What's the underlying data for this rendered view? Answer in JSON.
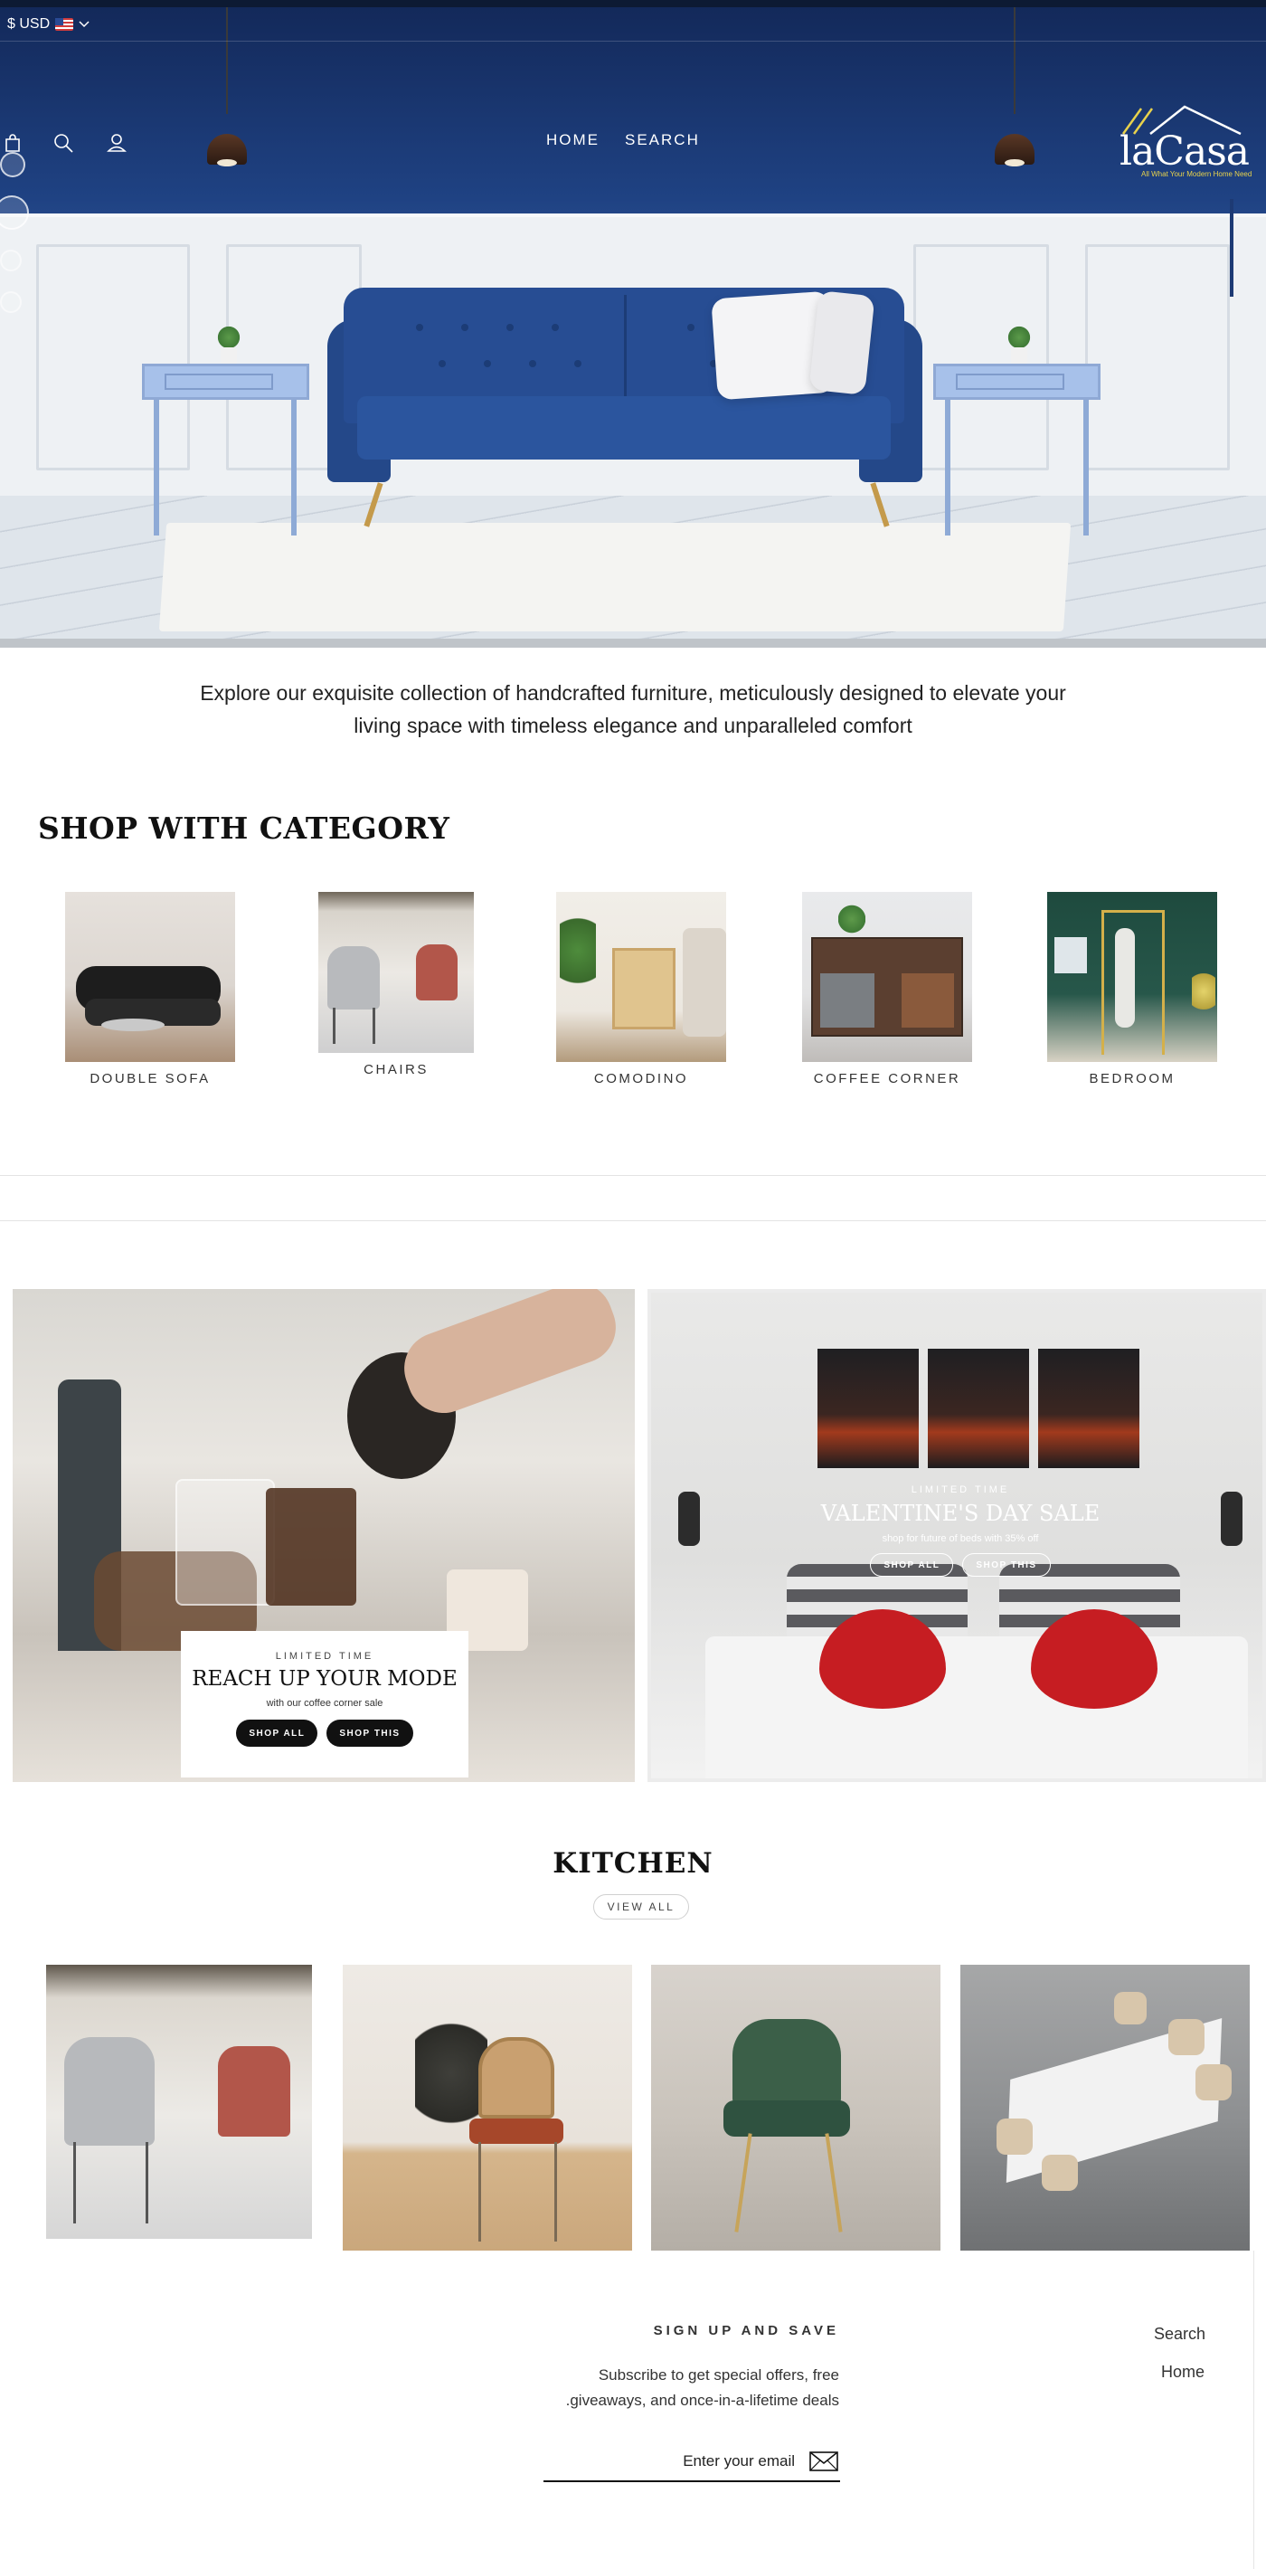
{
  "header": {
    "currency": "$ USD",
    "nav": [
      "HOME",
      "SEARCH"
    ],
    "logo": {
      "text": "laCasa",
      "tagline": "All What Your Modern Home Need"
    }
  },
  "intro": {
    "text": "Explore our exquisite collection of handcrafted furniture, meticulously designed to elevate your living space with timeless elegance and unparalleled comfort"
  },
  "categories": {
    "title": "SHOP WITH CATEGORY",
    "items": [
      {
        "label": "DOUBLE SOFA"
      },
      {
        "label": "CHAIRS"
      },
      {
        "label": "COMODINO"
      },
      {
        "label": "COFFEE CORNER"
      },
      {
        "label": "BEDROOM"
      }
    ]
  },
  "promos": {
    "left": {
      "eyebrow": "LIMITED TIME",
      "title": "REACH UP YOUR MODE",
      "subtitle": "with our coffee corner sale",
      "btn_all": "SHOP ALL",
      "btn_this": "SHOP THIS"
    },
    "right": {
      "eyebrow": "LIMITED TIME",
      "title": "VALENTINE'S DAY SALE",
      "subtitle": "shop for future of beds with 35% off",
      "btn_all": "SHOP ALL",
      "btn_this": "SHOP THIS"
    }
  },
  "kitchen": {
    "title": "KITCHEN",
    "view_all": "VIEW ALL"
  },
  "footer": {
    "signup_title": "SIGN UP AND SAVE",
    "signup_text_1": "Subscribe to get special offers, free",
    "signup_text_2": ".giveaways, and once-in-a-lifetime deals",
    "email_placeholder": "Enter your email",
    "links": [
      "Search",
      "Home"
    ]
  },
  "colors": {
    "hero_navy": "#1f4283",
    "sofa_blue": "#274d93",
    "accent_dark": "#111111",
    "logo_yellow": "#e8d24c"
  },
  "icons": [
    "us-flag-icon",
    "chevron-down-icon",
    "cart-icon",
    "search-icon",
    "account-icon",
    "mail-icon"
  ]
}
